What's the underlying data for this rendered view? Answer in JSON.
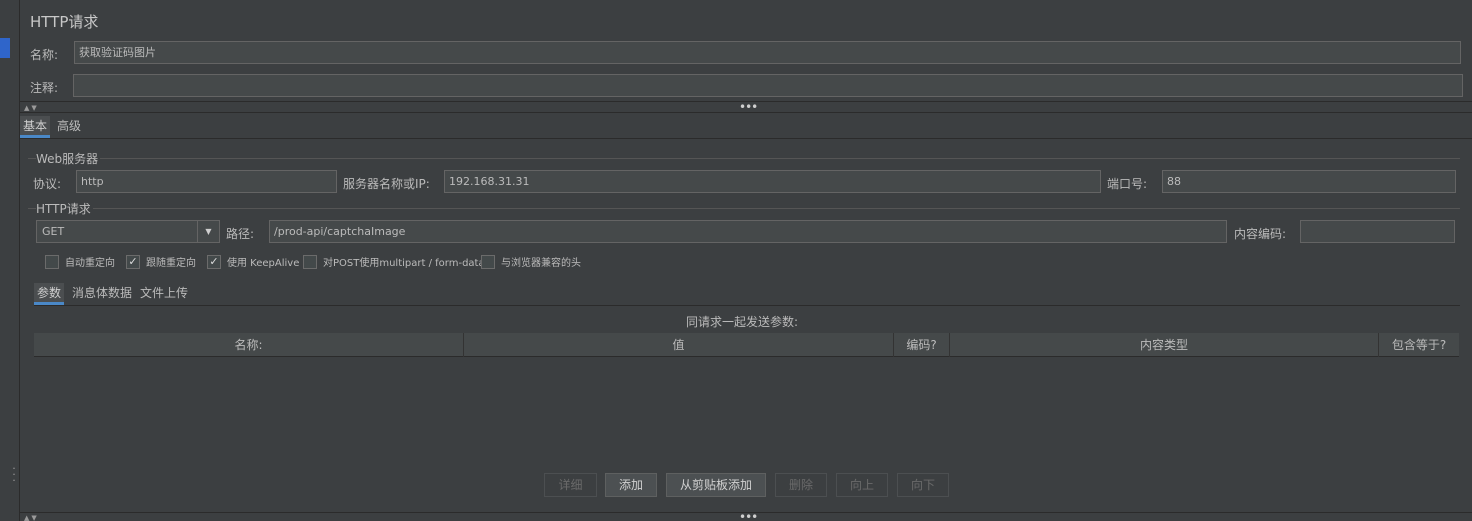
{
  "panel": {
    "title": "HTTP请求"
  },
  "name_row": {
    "label": "名称:",
    "value": "获取验证码图片"
  },
  "comment_row": {
    "label": "注释:",
    "value": ""
  },
  "tabs": [
    {
      "label": "基本",
      "active": true
    },
    {
      "label": "高级",
      "active": false
    }
  ],
  "web_server": {
    "group_title": "Web服务器",
    "protocol_label": "协议:",
    "protocol_value": "http",
    "server_label": "服务器名称或IP:",
    "server_value": "192.168.31.31",
    "port_label": "端口号:",
    "port_value": "88"
  },
  "http_request": {
    "group_title": "HTTP请求",
    "method": "GET",
    "path_label": "路径:",
    "path_value": "/prod-api/captchaImage",
    "encoding_label": "内容编码:",
    "encoding_value": ""
  },
  "checkboxes": [
    {
      "label": "自动重定向",
      "checked": false
    },
    {
      "label": "跟随重定向",
      "checked": true
    },
    {
      "label": "使用 KeepAlive",
      "checked": true
    },
    {
      "label": "对POST使用multipart / form-data",
      "checked": false
    },
    {
      "label": "与浏览器兼容的头",
      "checked": false
    }
  ],
  "sub_tabs": [
    {
      "label": "参数",
      "active": true
    },
    {
      "label": "消息体数据",
      "active": false
    },
    {
      "label": "文件上传",
      "active": false
    }
  ],
  "params_table": {
    "caption": "同请求一起发送参数:",
    "columns": [
      "名称:",
      "值",
      "编码?",
      "内容类型",
      "包含等于?"
    ]
  },
  "buttons": [
    {
      "label": "详细",
      "enabled": false
    },
    {
      "label": "添加",
      "enabled": true
    },
    {
      "label": "从剪贴板添加",
      "enabled": true
    },
    {
      "label": "删除",
      "enabled": false
    },
    {
      "label": "向上",
      "enabled": false
    },
    {
      "label": "向下",
      "enabled": false
    }
  ],
  "colors": {
    "background": "#3c3f41",
    "field": "#45494a",
    "accent": "#4a88c7",
    "selection": "#2f65ca"
  }
}
